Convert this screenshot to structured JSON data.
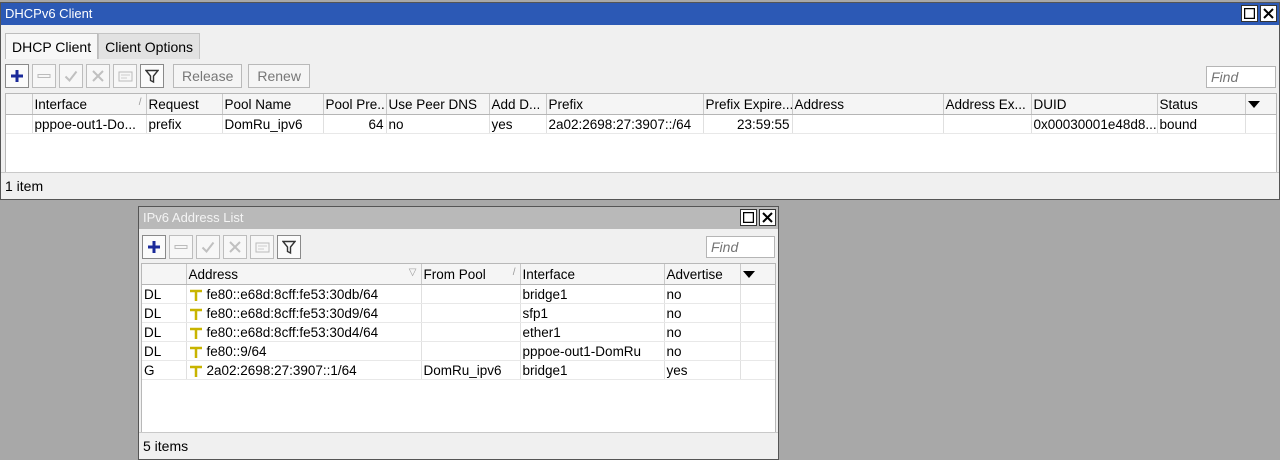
{
  "dhcp_window": {
    "title": "DHCPv6 Client",
    "tabs": [
      {
        "label": "DHCP Client"
      },
      {
        "label": "Client Options"
      }
    ],
    "toolbar": {
      "release_label": "Release",
      "renew_label": "Renew",
      "find_placeholder": "Find"
    },
    "columns": [
      "Interface",
      "Request",
      "Pool Name",
      "Pool Pre...",
      "Use Peer DNS",
      "Add D...",
      "Prefix",
      "Prefix Expire...",
      "Address",
      "Address Ex...",
      "DUID",
      "Status"
    ],
    "row": {
      "interface": "pppoe-out1-Do...",
      "request": "prefix",
      "pool_name": "DomRu_ipv6",
      "pool_prefix": "64",
      "use_peer_dns": "no",
      "add_default": "yes",
      "prefix": "2a02:2698:27:3907::/64",
      "prefix_expire": "23:59:55",
      "address": "",
      "address_expire": "",
      "duid": "0x00030001e48d8...",
      "status": "bound"
    },
    "status_text": "1 item"
  },
  "ipv6_window": {
    "title": "IPv6 Address List",
    "toolbar": {
      "find_placeholder": "Find"
    },
    "columns": [
      "Address",
      "From Pool",
      "Interface",
      "Advertise"
    ],
    "rows": [
      {
        "flag": "DL",
        "address": "fe80::e68d:8cff:fe53:30db/64",
        "from_pool": "",
        "interface": "bridge1",
        "advertise": "no"
      },
      {
        "flag": "DL",
        "address": "fe80::e68d:8cff:fe53:30d9/64",
        "from_pool": "",
        "interface": "sfp1",
        "advertise": "no"
      },
      {
        "flag": "DL",
        "address": "fe80::e68d:8cff:fe53:30d4/64",
        "from_pool": "",
        "interface": "ether1",
        "advertise": "no"
      },
      {
        "flag": "DL",
        "address": "fe80::9/64",
        "from_pool": "",
        "interface": "pppoe-out1-DomRu",
        "advertise": "no"
      },
      {
        "flag": "G",
        "address": "2a02:2698:27:3907::1/64",
        "from_pool": "DomRu_ipv6",
        "interface": "bridge1",
        "advertise": "yes"
      }
    ],
    "status_text": "5 items"
  },
  "icons": {
    "add": "plus-icon",
    "remove": "minus-icon",
    "enable": "check-icon",
    "disable": "x-icon",
    "comment": "comment-icon",
    "filter": "filter-icon",
    "address": "address-pin-icon"
  },
  "colors": {
    "active_title": "#2c59b5",
    "inactive_title": "#b9b9b9",
    "plus": "#1a2a9a",
    "address_icon": "#c8b400"
  }
}
